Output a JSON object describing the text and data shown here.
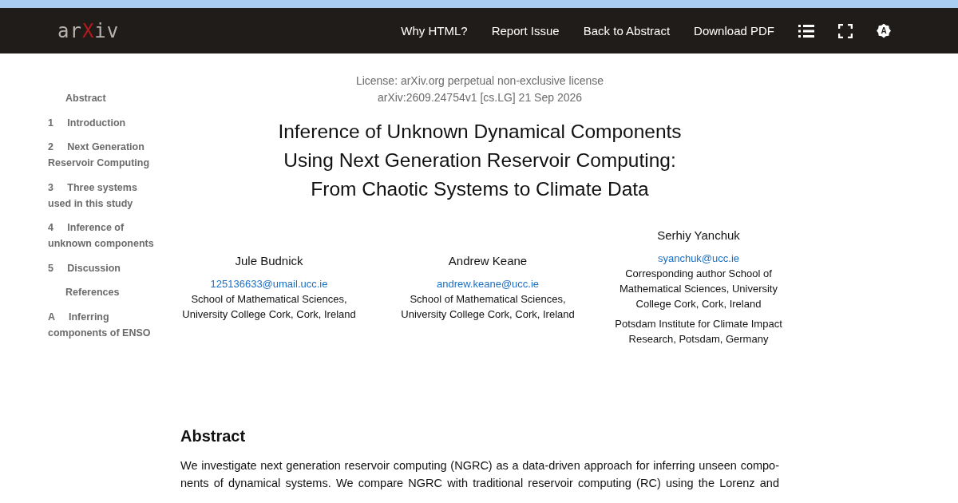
{
  "header": {
    "logo": {
      "prefix": "ar",
      "mark": "X",
      "suffix": "iv"
    },
    "links": [
      "Why HTML?",
      "Report Issue",
      "Back to Abstract",
      "Download PDF"
    ],
    "icons": [
      {
        "kind": "list"
      },
      {
        "kind": "fullscreen"
      },
      {
        "kind": "theme",
        "label": "A"
      }
    ]
  },
  "toc": [
    {
      "title": "Abstract"
    },
    {
      "number": "1",
      "title": "Introduction"
    },
    {
      "number": "2",
      "title": "Next Generation Reservoir Computing"
    },
    {
      "number": "3",
      "title": "Three systems used in this study"
    },
    {
      "number": "4",
      "title": "Inference of unknown components"
    },
    {
      "number": "5",
      "title": "Discussion"
    },
    {
      "title": "References"
    },
    {
      "number": "A",
      "title": "Inferring components of ENSO"
    }
  ],
  "paper": {
    "license": "License: arXiv.org perpetual non-exclusive license",
    "identifier": "arXiv:2609.24754v1 [cs.LG] 21 Sep 2026",
    "title_lines": [
      "Inference of Unknown Dynamical Components",
      "Using Next Generation Reservoir Computing:",
      "From Chaotic Systems to Climate Data"
    ],
    "authors": [
      {
        "name": "Jule Budnick",
        "email": "125136633@umail.ucc.ie",
        "affiliations": [
          "School of Mathematical Sciences, University College Cork, Cork, Ireland"
        ]
      },
      {
        "name": "Andrew Keane",
        "email": "andrew.keane@ucc.ie",
        "affiliations": [
          "School of Mathematical Sciences, University College Cork, Cork, Ireland"
        ]
      },
      {
        "name": "Serhiy Yanchuk",
        "email": "syanchuk@ucc.ie",
        "affiliations": [
          "Corresponding author School of Mathematical Sciences, University College Cork, Cork, Ireland",
          "Potsdam Institute for Climate Impact Research, Potsdam, Germany"
        ]
      }
    ],
    "abstract": {
      "heading": "Abstract",
      "lines": [
        "We investigate next generation reservoir computing (NGRC) as a data-driven approach for inferring unseen compo-",
        "nents of dynamical systems. We compare NGRC with traditional reservoir computing (RC) using the Lorenz and"
      ]
    }
  }
}
